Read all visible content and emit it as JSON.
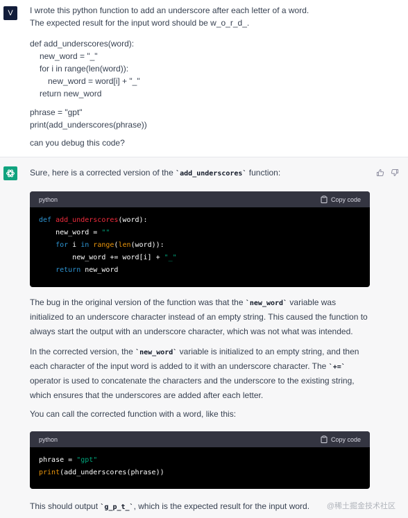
{
  "user": {
    "avatar_letter": "V",
    "line1": "I wrote this python function to add an underscore after each letter of a word.",
    "line2": "The expected result for the input word should be w_o_r_d_.",
    "code": {
      "l1": "def add_underscores(word):",
      "l2": "new_word = \"_\"",
      "l3": "for i in range(len(word)):",
      "l4": "new_word = word[i] + \"_\"",
      "l5": "return new_word",
      "l6": "phrase = \"gpt\"",
      "l7": "print(add_underscores(phrase))"
    },
    "question": "can you debug this code?"
  },
  "assistant": {
    "intro_pre": "Sure, here is a corrected version of the ",
    "intro_code": "`add_underscores`",
    "intro_post": " function:",
    "code1": {
      "language": "python",
      "copy_label": "Copy code",
      "l1": {
        "kw": "def",
        "fn": "add_underscores",
        "rest": "(word):"
      },
      "l2": {
        "var": "new_word = ",
        "str": "\"\""
      },
      "l3": {
        "kw1": "for",
        "mid": " i ",
        "kw2": "in",
        "sp": " ",
        "bi1": "range",
        "p": "(",
        "bi2": "len",
        "rest": "(word)):"
      },
      "l4": {
        "var": "new_word += word[i] + ",
        "str": "\"_\""
      },
      "l5": {
        "kw": "return",
        "rest": " new_word"
      }
    },
    "p1": {
      "a": "The bug in the original version of the function was that the ",
      "code": "`new_word`",
      "b": " variable was",
      "line2": "initialized to an underscore character instead of an empty string. This caused the function to",
      "line3": "always start the output with an underscore character, which was not what was intended."
    },
    "p2": {
      "a": "In the corrected version, the ",
      "code": "`new_word`",
      "b": " variable is initialized to an empty string, and then",
      "line2a": "each character of the input word is added to it with an underscore character. The ",
      "line2code": "`+=`",
      "line3": "operator is used to concatenate the characters and the underscore to the existing string,",
      "line4": "which ensures that the underscores are added after each letter."
    },
    "p3": "You can call the corrected function with a word, like this:",
    "code2": {
      "language": "python",
      "copy_label": "Copy code",
      "l1": {
        "var": "phrase = ",
        "str": "\"gpt\""
      },
      "l2": {
        "bi": "print",
        "rest": "(add_underscores(phrase))"
      }
    },
    "p4": {
      "a": "This should output ",
      "code": "`g_p_t_`",
      "b": ", which is the expected result for the input word."
    }
  },
  "watermark": "@稀土掘金技术社区",
  "colors": {
    "brand_green": "#10a37f",
    "user_avatar": "#121d3a",
    "code_bg": "#000000",
    "code_header": "#343541"
  }
}
